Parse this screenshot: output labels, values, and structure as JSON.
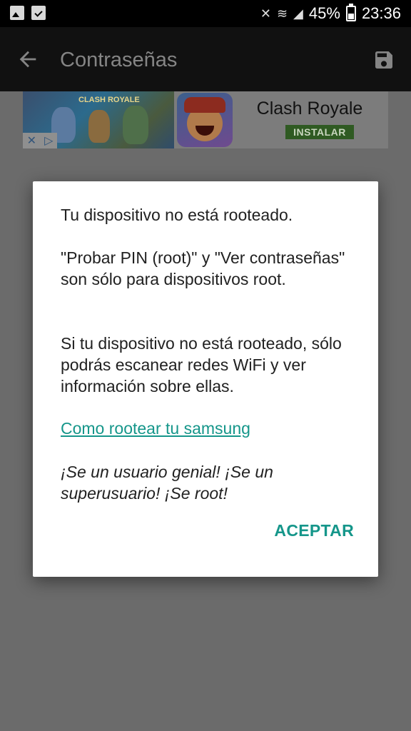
{
  "status_bar": {
    "battery_percent": "45%",
    "time": "23:36",
    "icons": [
      "image-icon",
      "clipboard-check-icon",
      "mute-vibrate-icon",
      "wifi-icon",
      "signal-icon",
      "battery-icon"
    ]
  },
  "app_bar": {
    "title": "Contraseñas",
    "back_icon": "arrow-left-icon",
    "save_icon": "floppy-disk-icon"
  },
  "ad": {
    "game_name": "Clash Royale",
    "install_label": "INSTALAR",
    "art_logo_text": "CLASH ROYALE"
  },
  "dialog": {
    "paragraph_1": "Tu dispositivo no está rooteado.",
    "paragraph_2": "\"Probar PIN (root)\" y \"Ver contraseñas\" son sólo para dispositivos root.",
    "paragraph_3": "Si tu dispositivo no está rooteado, sólo podrás escanear redes WiFi y ver información sobre ellas.",
    "link": "Como rootear tu samsung",
    "paragraph_4": "¡Se un usuario genial! ¡Se un superusuario! ¡Se root!",
    "accept_label": "ACEPTAR"
  },
  "colors": {
    "accent": "#15968a",
    "scrim": "#6b6b6b",
    "appbar": "#111111"
  }
}
